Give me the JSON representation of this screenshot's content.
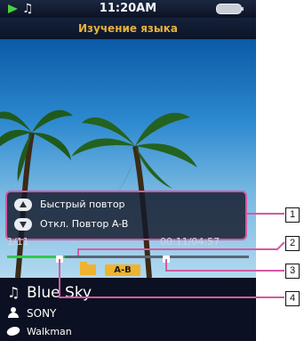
{
  "status": {
    "time": "11:20AM"
  },
  "app": {
    "title": "Изучение языка"
  },
  "context_menu": {
    "items": [
      {
        "key_icon": "up-key-icon",
        "label": "Быстрый повтор"
      },
      {
        "key_icon": "down-key-icon",
        "label": "Откл. Повтор A-B"
      }
    ]
  },
  "playback": {
    "track_counter": "1/11",
    "time": "00:11/04:57",
    "progress": 0.24,
    "repeat_badge": "A-B"
  },
  "now_playing": {
    "song": "Blue Sky",
    "artist": "SONY",
    "album": "Walkman"
  },
  "callouts": [
    "1",
    "2",
    "3",
    "4"
  ],
  "colors": {
    "accent": "#e7b23a",
    "highlight": "#d35aa4",
    "progress": "#31c94a"
  }
}
